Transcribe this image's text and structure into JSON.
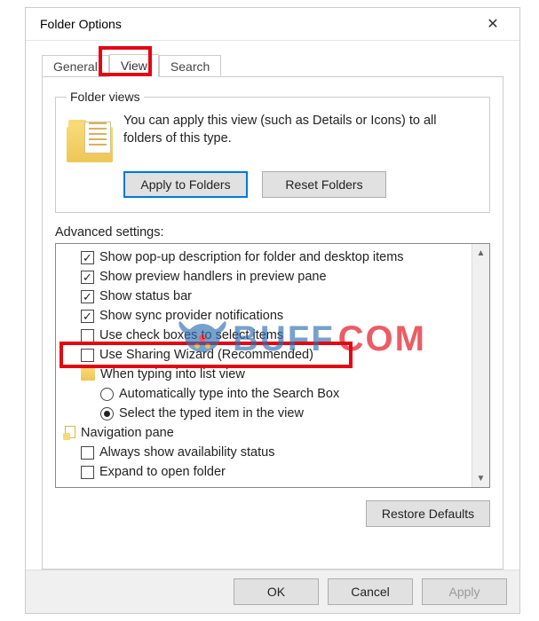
{
  "window": {
    "title": "Folder Options",
    "close_icon": "✕"
  },
  "tabs": {
    "general": "General",
    "view": "View",
    "search": "Search",
    "active": "view"
  },
  "folder_views": {
    "legend": "Folder views",
    "description": "You can apply this view (such as Details or Icons) to all folders of this type.",
    "apply_btn": "Apply to Folders",
    "reset_btn": "Reset Folders"
  },
  "advanced": {
    "label": "Advanced settings:",
    "items": [
      {
        "kind": "checkbox",
        "checked": true,
        "indent": 1,
        "label": "Show pop-up description for folder and desktop items"
      },
      {
        "kind": "checkbox",
        "checked": true,
        "indent": 1,
        "label": "Show preview handlers in preview pane"
      },
      {
        "kind": "checkbox",
        "checked": true,
        "indent": 1,
        "label": "Show status bar"
      },
      {
        "kind": "checkbox",
        "checked": true,
        "indent": 1,
        "label": "Show sync provider notifications"
      },
      {
        "kind": "checkbox",
        "checked": false,
        "indent": 1,
        "label": "Use check boxes to select items"
      },
      {
        "kind": "checkbox",
        "checked": false,
        "indent": 1,
        "label": "Use Sharing Wizard (Recommended)",
        "highlight": true
      },
      {
        "kind": "folder",
        "indent": 1,
        "label": "When typing into list view"
      },
      {
        "kind": "radio",
        "checked": false,
        "indent": 2,
        "label": "Automatically type into the Search Box"
      },
      {
        "kind": "radio",
        "checked": true,
        "indent": 2,
        "label": "Select the typed item in the view"
      },
      {
        "kind": "navpane",
        "indent": 0,
        "label": "Navigation pane"
      },
      {
        "kind": "checkbox",
        "checked": false,
        "indent": 1,
        "label": "Always show availability status"
      },
      {
        "kind": "checkbox",
        "checked": false,
        "indent": 1,
        "label": "Expand to open folder"
      }
    ],
    "restore_btn": "Restore Defaults"
  },
  "footer": {
    "ok": "OK",
    "cancel": "Cancel",
    "apply": "Apply"
  },
  "scroll": {
    "up": "▲",
    "down": "▼"
  },
  "watermark": {
    "a": "BUFF",
    "b": "COM"
  }
}
